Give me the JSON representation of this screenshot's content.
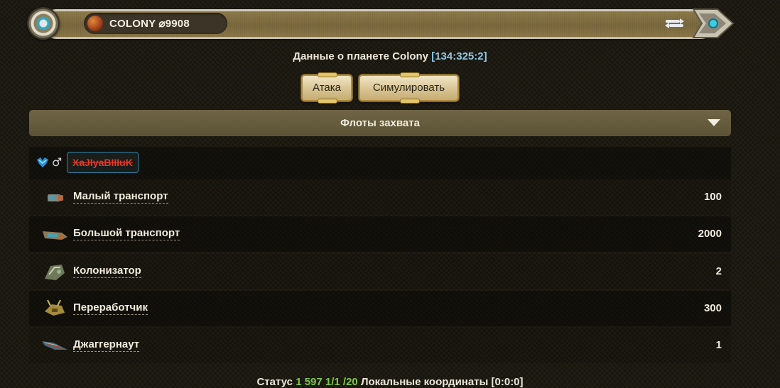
{
  "planet_bar": {
    "planet_name": "COLONY ⌀9908"
  },
  "info": {
    "prefix": "Данные о планете Colony",
    "coords": "[134:325:2]"
  },
  "buttons": {
    "attack": "Атака",
    "simulate": "Симулировать"
  },
  "section": {
    "title": "Флоты захвата"
  },
  "player": {
    "name": "XaJIyaBIIIuK"
  },
  "ships": [
    {
      "name": "Малый транспорт",
      "count": "100",
      "icon": "small-cargo-icon"
    },
    {
      "name": "Большой транспорт",
      "count": "2000",
      "icon": "large-cargo-icon"
    },
    {
      "name": "Колонизатор",
      "count": "2",
      "icon": "colony-ship-icon"
    },
    {
      "name": "Переработчик",
      "count": "300",
      "icon": "recycler-icon"
    },
    {
      "name": "Джаггернаут",
      "count": "1",
      "icon": "juggernaut-icon"
    }
  ],
  "footer": {
    "prefix": "Статус",
    "status_values": "1 597 1/1 /20",
    "suffix": "Локальные координаты [0:0:0]"
  },
  "colors": {
    "accent_coords": "#8fc8e6",
    "player_name": "#e23a2a",
    "green": "#7ec94a"
  }
}
